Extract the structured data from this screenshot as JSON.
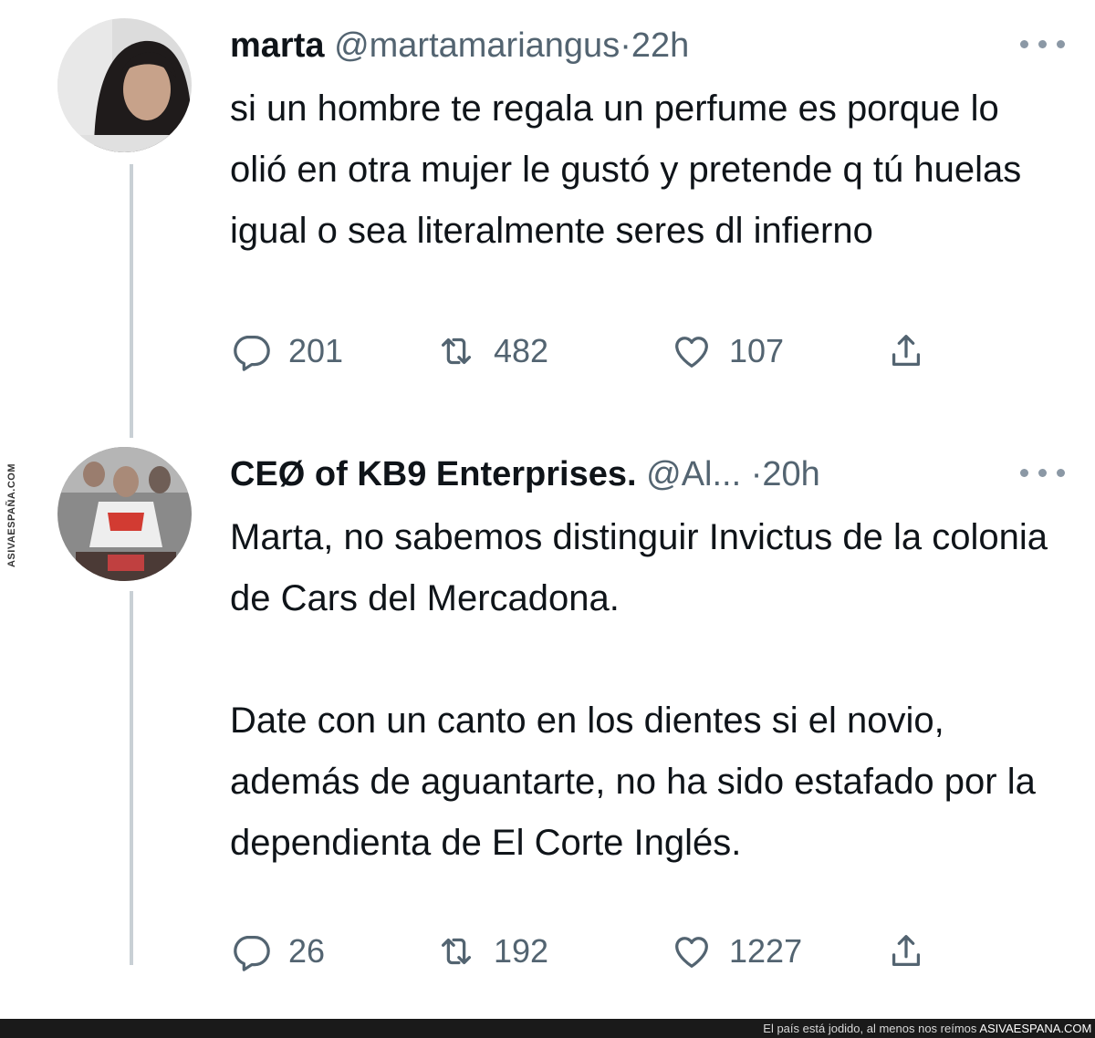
{
  "tweets": [
    {
      "name": "marta",
      "handle": "@martamariangus",
      "dot": "·",
      "time": "22h",
      "text": [
        "si un hombre te regala un perfume es porque lo olió en otra mujer le gustó y pretende q tú huelas igual o sea literalmente seres dl infierno"
      ],
      "replies": "201",
      "retweets": "482",
      "likes": "107",
      "avatar_colors": {
        "bg": "#d9d9d9",
        "hair": "#1e1a1a",
        "skin": "#c9a58d"
      }
    },
    {
      "name": "CEØ of KB9 Enterprises.",
      "handle": "@Al...",
      "dot": "·",
      "time": "20h",
      "text": [
        "Marta, no sabemos distinguir Invictus de la colonia de Cars del Mercadona.",
        "Date con un canto en los dientes si el novio, además de aguantarte, no ha sido estafado por la dependienta de El Corte Inglés."
      ],
      "replies": "26",
      "retweets": "192",
      "likes": "1227",
      "avatar_colors": {
        "bg": "#8e8e8e",
        "accent": "#d23b32"
      }
    }
  ],
  "icons": [
    "reply-icon",
    "retweet-icon",
    "like-icon",
    "share-icon",
    "more-icon"
  ],
  "colors": {
    "text": "#0f1419",
    "secondary": "#536471",
    "thread": "#c9d0d5"
  },
  "footer": {
    "tagline": "El país está jodido, al menos nos reímos",
    "brand": "ASIVAESPANA.COM"
  },
  "watermark": "ASIVAESPAÑA.COM"
}
